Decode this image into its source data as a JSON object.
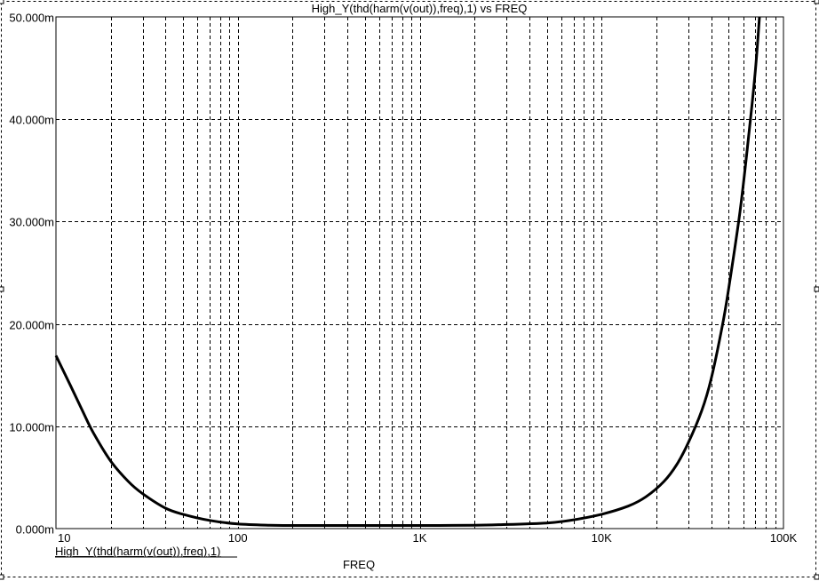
{
  "chart_data": {
    "type": "line",
    "title": "High_Y(thd(harm(v(out)),freq),1) vs FREQ",
    "xlabel": "FREQ",
    "ylabel": "",
    "xscale": "log",
    "xlim": [
      10,
      100000
    ],
    "ylim": [
      0,
      0.05
    ],
    "grid": true,
    "x_ticks": [
      {
        "value": 10,
        "label": "10"
      },
      {
        "value": 100,
        "label": "100"
      },
      {
        "value": 1000,
        "label": "1K"
      },
      {
        "value": 10000,
        "label": "10K"
      },
      {
        "value": 100000,
        "label": "100K"
      }
    ],
    "y_ticks": [
      {
        "value": 0,
        "label": "0.000m"
      },
      {
        "value": 0.01,
        "label": "10.000m"
      },
      {
        "value": 0.02,
        "label": "20.000m"
      },
      {
        "value": 0.03,
        "label": "30.000m"
      },
      {
        "value": 0.04,
        "label": "40.000m"
      },
      {
        "value": 0.05,
        "label": "50.000m"
      }
    ],
    "legend": {
      "placement": "bottom-left",
      "label": "High_Y(thd(harm(v(out)),freq),1)"
    },
    "series": [
      {
        "name": "High_Y(thd(harm(v(out)),freq),1)",
        "color": "#000000",
        "x": [
          10,
          12,
          14,
          16,
          20,
          25,
          30,
          40,
          50,
          70,
          100,
          150,
          200,
          500,
          1000,
          2000,
          3000,
          5000,
          6600,
          10000,
          14000,
          17500,
          22000,
          26000,
          30000,
          35500,
          40000,
          46000,
          50000,
          57700,
          64600,
          70000,
          73800
        ],
        "y": [
          0.0169,
          0.014,
          0.0115,
          0.0094,
          0.0066,
          0.0046,
          0.0034,
          0.002,
          0.0014,
          0.0008,
          0.00045,
          0.00032,
          0.0003,
          0.0003,
          0.0003,
          0.00032,
          0.0004,
          0.00055,
          0.00078,
          0.0014,
          0.0022,
          0.0031,
          0.0046,
          0.0063,
          0.0084,
          0.0115,
          0.0146,
          0.0197,
          0.0235,
          0.031,
          0.0386,
          0.0447,
          0.05
        ]
      }
    ]
  }
}
